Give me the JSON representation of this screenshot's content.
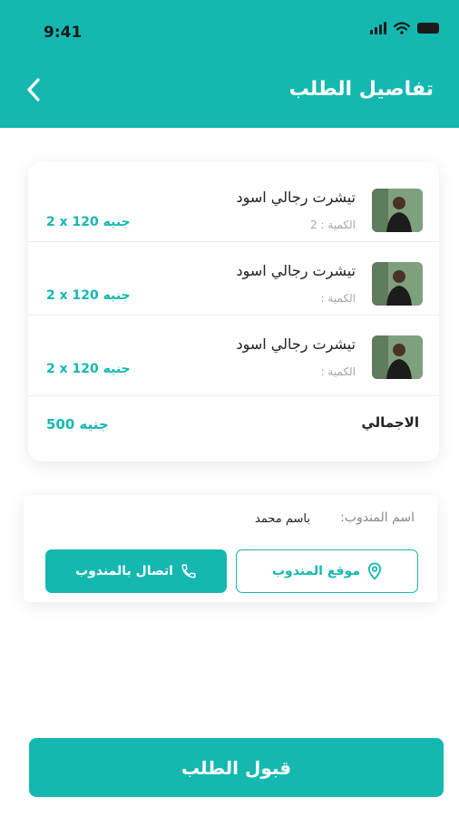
{
  "status_bar": {
    "time": "9:41"
  },
  "header": {
    "title": "تفاصيل الطلب",
    "back_icon": "chevron-left-icon"
  },
  "order": {
    "items": [
      {
        "name": "تيشرت رجالي اسود",
        "qty_label": "الكمية : 2",
        "price": "2 x 120 جنيه"
      },
      {
        "name": "تيشرت رجالي اسود",
        "qty_label": "الكمية :",
        "price": "2 x 120 جنيه"
      },
      {
        "name": "تيشرت رجالي اسود",
        "qty_label": "الكمية :",
        "price": "2 x 120 جنيه"
      }
    ],
    "total_label": "الاجمالي",
    "total_value": "500 جنيه"
  },
  "agent": {
    "label": "اسم المندوب:",
    "name": "باسم محمد",
    "location_button": "موقع المندوب",
    "call_button": "اتصال بالمندوب"
  },
  "accept_button": "قبول الطلب",
  "colors": {
    "accent": "#14b8b0",
    "text": "#222222",
    "muted": "#a5a5a5"
  }
}
